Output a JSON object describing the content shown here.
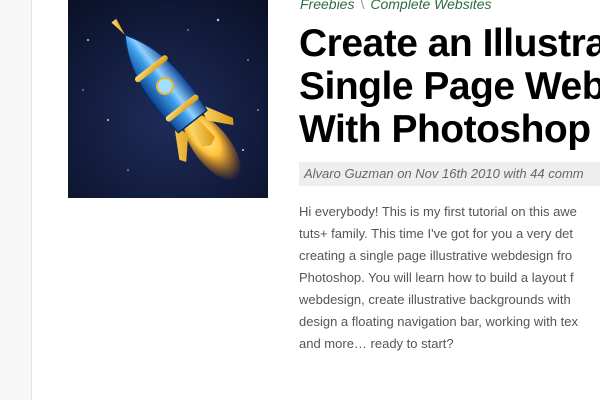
{
  "breadcrumb": {
    "category": "Freebies",
    "separator": "\\",
    "subcategory": "Complete Websites"
  },
  "post": {
    "title_lines": [
      "Create an Illustra",
      "Single Page Web",
      "With Photoshop"
    ],
    "meta": "Alvaro Guzman on Nov 16th 2010 with 44 comm",
    "excerpt_lines": [
      "Hi everybody! This is my first tutorial on this awe",
      "tuts+ family. This time I've got for you a very det",
      "creating a single page illustrative webdesign fro",
      "Photoshop. You will learn how to build a layout f",
      "webdesign, create illustrative backgrounds with",
      "design a floating navigation bar, working with tex",
      "and more… ready to start?"
    ],
    "thumbnail_icon": "rocket-icon"
  },
  "colors": {
    "link": "#2f6b3d",
    "title": "#000000",
    "meta_bg": "#eeeeee",
    "thumb_bg": "#101a36"
  }
}
